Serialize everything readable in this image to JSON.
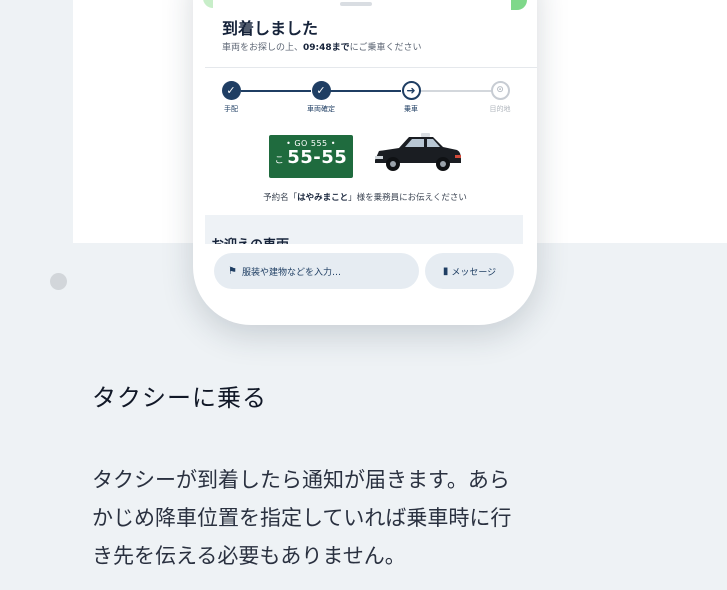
{
  "app": {
    "status_title": "到着しました",
    "status_sub_prefix": "車両をお探しの上、",
    "status_time": "09:48まで",
    "status_sub_suffix": "にご乗車ください",
    "steps": [
      {
        "label": "手配",
        "state": "done"
      },
      {
        "label": "車両確定",
        "state": "done"
      },
      {
        "label": "乗車",
        "state": "current"
      },
      {
        "label": "目的地",
        "state": "future"
      }
    ],
    "plate": {
      "top": "• GO 555 •",
      "kana": "こ",
      "number": "55-55",
      "color": "#1f6b3e"
    },
    "reservation": {
      "prefix": "予約名「",
      "name": "はやみまこと",
      "suffix": "」様を乗務員にお伝えください"
    },
    "section_title": "お迎えの車両",
    "location_input": {
      "placeholder": "服装や建物などを入力…",
      "icon": "flag-icon"
    },
    "message_button": {
      "label": "メッセージ",
      "icon": "chat-icon"
    }
  },
  "heading": "タクシーに乗る",
  "description_lines": [
    "タクシーが到着したら通知が届きます。あら",
    "かじめ降車位置を指定していれば乗車時に行",
    "き先を伝える必要もありません。"
  ],
  "colors": {
    "accent": "#1f3e63",
    "plate_green": "#1f6b3e",
    "page_bg": "#eef2f5"
  }
}
